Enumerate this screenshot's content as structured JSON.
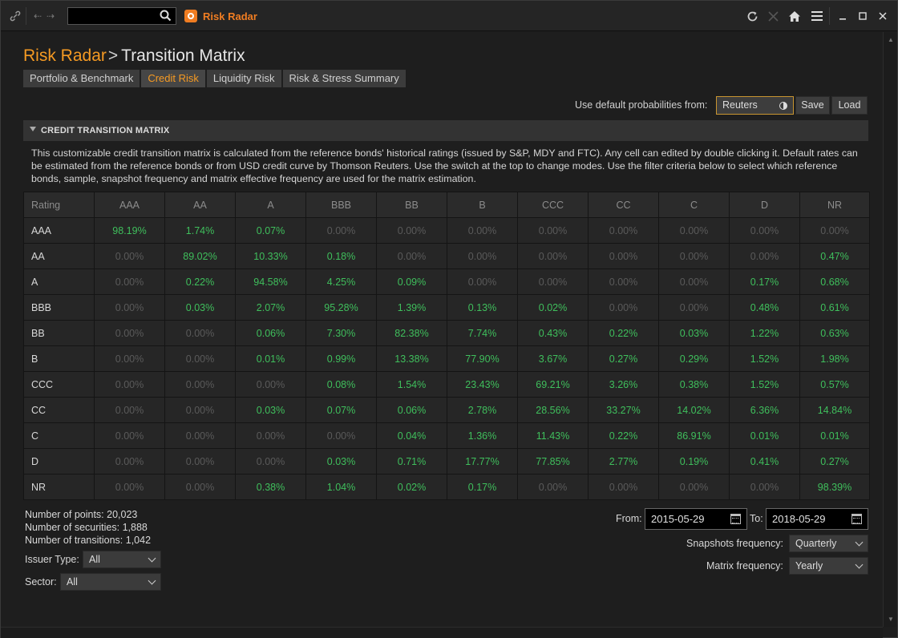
{
  "app": {
    "name": "Risk Radar",
    "breadcrumb_sep": ">",
    "page_title": "Transition Matrix"
  },
  "tabs": [
    {
      "label": "Portfolio & Benchmark",
      "active": false
    },
    {
      "label": "Credit Risk",
      "active": true
    },
    {
      "label": "Liquidity Risk",
      "active": false
    },
    {
      "label": "Risk & Stress Summary",
      "active": false
    }
  ],
  "defaults": {
    "label": "Use default probabilities from:",
    "source": "Reuters",
    "save_label": "Save",
    "load_label": "Load"
  },
  "section": {
    "title": "CREDIT TRANSITION MATRIX",
    "description": "This customizable credit transition matrix is calculated from the reference bonds' historical ratings (issued by S&P, MDY and FTC). Any cell can edited by double clicking it. Default rates can be estimated from the reference bonds or from USD credit curve by Thomson Reuters. Use the switch at the top to change modes. Use the filter criteria below to select which reference bonds, sample, snapshot frequency and matrix effective frequency are used for the matrix estimation."
  },
  "matrix": {
    "corner_label": "Rating",
    "columns": [
      "AAA",
      "AA",
      "A",
      "BBB",
      "BB",
      "B",
      "CCC",
      "CC",
      "C",
      "D",
      "NR"
    ],
    "rows": [
      {
        "rating": "AAA",
        "values": [
          "98.19%",
          "1.74%",
          "0.07%",
          "0.00%",
          "0.00%",
          "0.00%",
          "0.00%",
          "0.00%",
          "0.00%",
          "0.00%",
          "0.00%"
        ]
      },
      {
        "rating": "AA",
        "values": [
          "0.00%",
          "89.02%",
          "10.33%",
          "0.18%",
          "0.00%",
          "0.00%",
          "0.00%",
          "0.00%",
          "0.00%",
          "0.00%",
          "0.47%"
        ]
      },
      {
        "rating": "A",
        "values": [
          "0.00%",
          "0.22%",
          "94.58%",
          "4.25%",
          "0.09%",
          "0.00%",
          "0.00%",
          "0.00%",
          "0.00%",
          "0.17%",
          "0.68%"
        ]
      },
      {
        "rating": "BBB",
        "values": [
          "0.00%",
          "0.03%",
          "2.07%",
          "95.28%",
          "1.39%",
          "0.13%",
          "0.02%",
          "0.00%",
          "0.00%",
          "0.48%",
          "0.61%"
        ]
      },
      {
        "rating": "BB",
        "values": [
          "0.00%",
          "0.00%",
          "0.06%",
          "7.30%",
          "82.38%",
          "7.74%",
          "0.43%",
          "0.22%",
          "0.03%",
          "1.22%",
          "0.63%"
        ]
      },
      {
        "rating": "B",
        "values": [
          "0.00%",
          "0.00%",
          "0.01%",
          "0.99%",
          "13.38%",
          "77.90%",
          "3.67%",
          "0.27%",
          "0.29%",
          "1.52%",
          "1.98%"
        ]
      },
      {
        "rating": "CCC",
        "values": [
          "0.00%",
          "0.00%",
          "0.00%",
          "0.08%",
          "1.54%",
          "23.43%",
          "69.21%",
          "3.26%",
          "0.38%",
          "1.52%",
          "0.57%"
        ]
      },
      {
        "rating": "CC",
        "values": [
          "0.00%",
          "0.00%",
          "0.03%",
          "0.07%",
          "0.06%",
          "2.78%",
          "28.56%",
          "33.27%",
          "14.02%",
          "6.36%",
          "14.84%"
        ]
      },
      {
        "rating": "C",
        "values": [
          "0.00%",
          "0.00%",
          "0.00%",
          "0.00%",
          "0.04%",
          "1.36%",
          "11.43%",
          "0.22%",
          "86.91%",
          "0.01%",
          "0.01%"
        ]
      },
      {
        "rating": "D",
        "values": [
          "0.00%",
          "0.00%",
          "0.00%",
          "0.03%",
          "0.71%",
          "17.77%",
          "77.85%",
          "2.77%",
          "0.19%",
          "0.41%",
          "0.27%"
        ]
      },
      {
        "rating": "NR",
        "values": [
          "0.00%",
          "0.00%",
          "0.38%",
          "1.04%",
          "0.02%",
          "0.17%",
          "0.00%",
          "0.00%",
          "0.00%",
          "0.00%",
          "98.39%"
        ]
      }
    ]
  },
  "stats": {
    "points": "Number of points: 20,023",
    "securities": "Number of securities: 1,888",
    "transitions": "Number of transitions: 1,042"
  },
  "filters": {
    "issuer_type_label": "Issuer Type:",
    "issuer_type_value": "All",
    "sector_label": "Sector:",
    "sector_value": "All",
    "from_label": "From:",
    "from_value": "2015-05-29",
    "to_label": "To:",
    "to_value": "2018-05-29",
    "snapshot_label": "Snapshots frequency:",
    "snapshot_value": "Quarterly",
    "matrix_freq_label": "Matrix frequency:",
    "matrix_freq_value": "Yearly"
  },
  "colors": {
    "accent": "#f59a23",
    "positive": "#3fbf5c",
    "zero": "#5a5a5a",
    "background": "#1e1e1e"
  },
  "icons": [
    "link-icon",
    "back-arrow-icon",
    "forward-arrow-icon",
    "search-icon",
    "app-icon",
    "refresh-icon",
    "close-x-icon",
    "home-icon",
    "menu-icon",
    "minimize-icon",
    "maximize-icon",
    "window-close-icon",
    "calendar-icon",
    "chevron-down-icon",
    "toggle-icon"
  ]
}
